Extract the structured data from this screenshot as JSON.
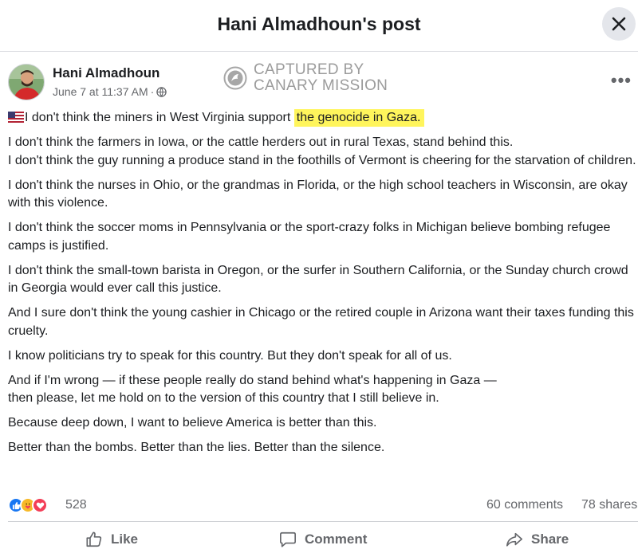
{
  "header": {
    "title": "Hani Almadhoun's post"
  },
  "post": {
    "author": "Hani Almadhoun",
    "timestamp": "June 7 at 11:37 AM",
    "privacy": "globe-icon",
    "more_label": "•••",
    "watermark": {
      "line1": "CAPTURED BY",
      "line2": "CANARY MISSION"
    },
    "body": {
      "p1_before": "I don't think the miners in West Virginia support ",
      "p1_highlight": "the genocide in Gaza.",
      "p2a": "I don't think the farmers in Iowa, or the cattle herders out in rural Texas, stand behind this.",
      "p2b": "I don't think the guy running a produce stand in the foothills of Vermont is cheering for the starvation of children.",
      "p3": "I don't think the nurses in Ohio, or the grandmas in Florida, or the high school teachers in Wisconsin, are okay with this violence.",
      "p4": "I don't think the soccer moms in Pennsylvania or the sport-crazy folks in Michigan believe bombing refugee camps is justified.",
      "p5": "I don't think the small-town barista in Oregon, or the surfer in Southern California, or the Sunday church crowd in Georgia would ever call this justice.",
      "p6": "And I sure don't think the young cashier in Chicago or the retired couple in Arizona want their taxes funding this cruelty.",
      "p7": "I know politicians try to speak for this country. But they don't speak for all of us.",
      "p8a": "And if I'm wrong — if these people really do stand behind what's happening in Gaza —",
      "p8b": "then please, let me hold on to the version of this country that I still believe in.",
      "p9": "Because deep down, I want to believe America is better than this.",
      "p10": "Better than the bombs. Better than the lies. Better than the silence."
    }
  },
  "engagement": {
    "reactions_count": "528",
    "comments": "60 comments",
    "shares": "78 shares",
    "reaction_types": [
      "like-icon",
      "care-icon",
      "love-icon"
    ]
  },
  "actions": {
    "like": "Like",
    "comment": "Comment",
    "share": "Share"
  },
  "colors": {
    "highlight": "#fff55c",
    "like_blue": "#1877f2",
    "love_red": "#f33e58",
    "care_yellow": "#f7b928",
    "secondary_text": "#65676b"
  }
}
